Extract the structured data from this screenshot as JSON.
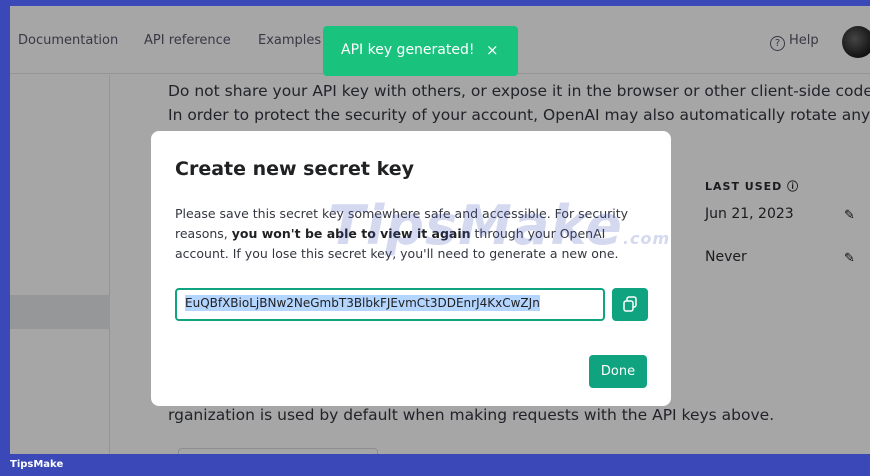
{
  "nav": {
    "links": [
      "Documentation",
      "API reference",
      "Examples"
    ],
    "help": "Help",
    "help_icon": "question-circle-icon"
  },
  "main": {
    "warning_text": "Do not share your API key with others, or expose it in the browser or other client-side code. In order to protect the security of your account, OpenAI may also automatically rotate any API key",
    "org_text": "rganization is used by default when making requests with the API keys above."
  },
  "table_peek": {
    "last_used_header": "LAST USED",
    "rows": [
      "Jun 21, 2023",
      "Never"
    ]
  },
  "toast": {
    "text": "API key generated!",
    "close": "×",
    "color": "#19c37d"
  },
  "modal": {
    "title": "Create new secret key",
    "desc_pre": "Please save this secret key somewhere safe and accessible. For security reasons, ",
    "desc_bold": "you won't be able to view it again",
    "desc_post": " through your OpenAI account. If you lose this secret key, you'll need to generate a new one.",
    "key_value": "EuQBfXBioLjBNw2NeGmbT3BlbkFJEvmCt3DDEnrJ4KxCwZJn",
    "copy_icon": "copy-icon",
    "done": "Done",
    "accent": "#10a37f"
  },
  "watermark": {
    "text": "TipsMake",
    "suffix": ".com"
  },
  "footer": {
    "brand": "TipsMake"
  }
}
